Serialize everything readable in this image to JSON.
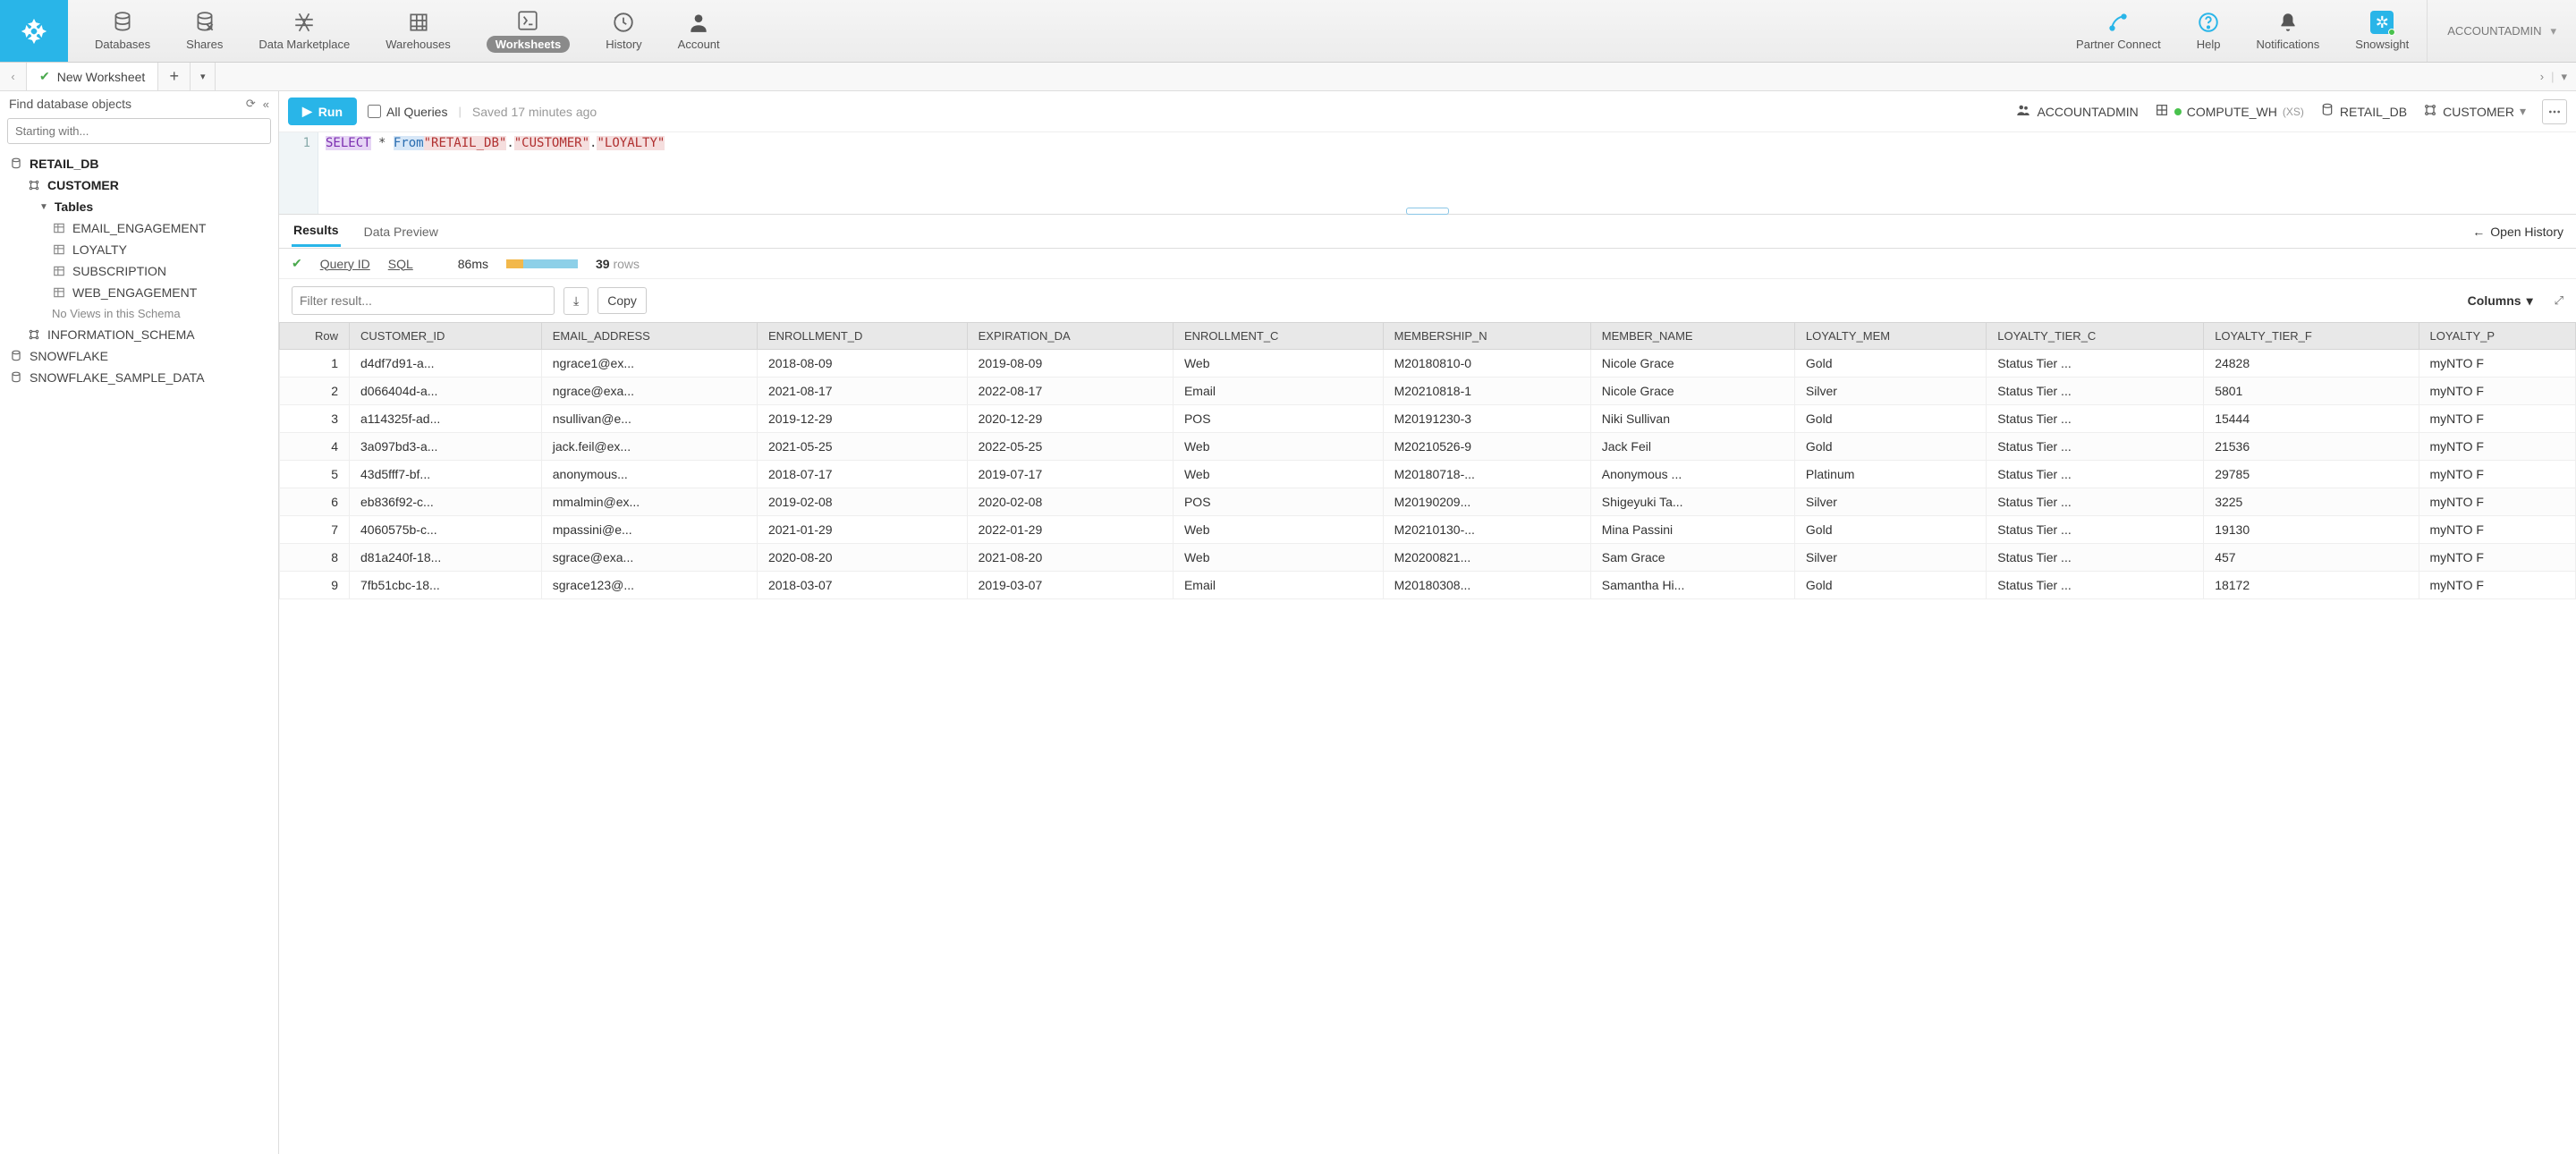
{
  "nav": {
    "items": [
      {
        "label": "Databases"
      },
      {
        "label": "Shares"
      },
      {
        "label": "Data Marketplace"
      },
      {
        "label": "Warehouses"
      },
      {
        "label": "Worksheets"
      },
      {
        "label": "History"
      },
      {
        "label": "Account"
      }
    ],
    "right": [
      {
        "label": "Partner Connect"
      },
      {
        "label": "Help"
      },
      {
        "label": "Notifications"
      },
      {
        "label": "Snowsight"
      }
    ],
    "account_role": "ACCOUNTADMIN"
  },
  "tabs": {
    "current": "New Worksheet"
  },
  "sidebar": {
    "find_label": "Find database objects",
    "search_placeholder": "Starting with...",
    "db": "RETAIL_DB",
    "schema": "CUSTOMER",
    "tables_label": "Tables",
    "tables": [
      "EMAIL_ENGAGEMENT",
      "LOYALTY",
      "SUBSCRIPTION",
      "WEB_ENGAGEMENT"
    ],
    "no_views": "No Views in this Schema",
    "info_schema": "INFORMATION_SCHEMA",
    "other_dbs": [
      "SNOWFLAKE",
      "SNOWFLAKE_SAMPLE_DATA"
    ]
  },
  "toolbar": {
    "run": "Run",
    "all_queries": "All Queries",
    "saved": "Saved 17 minutes ago",
    "role": "ACCOUNTADMIN",
    "warehouse": "COMPUTE_WH",
    "warehouse_size": "(XS)",
    "database": "RETAIL_DB",
    "schema": "CUSTOMER"
  },
  "editor": {
    "line_no": "1",
    "kw_select": "SELECT",
    "star": " * ",
    "kw_from": "From",
    "str1": "\"RETAIL_DB\"",
    "dot": ".",
    "str2": "\"CUSTOMER\"",
    "str3": "\"LOYALTY\""
  },
  "results": {
    "tab_results": "Results",
    "tab_preview": "Data Preview",
    "open_history": "Open History",
    "query_id": "Query ID",
    "sql": "SQL",
    "duration": "86ms",
    "row_count": "39",
    "rows_label": "rows",
    "filter_placeholder": "Filter result...",
    "copy": "Copy",
    "columns": "Columns",
    "headers": [
      "Row",
      "CUSTOMER_ID",
      "EMAIL_ADDRESS",
      "ENROLLMENT_D",
      "EXPIRATION_DA",
      "ENROLLMENT_C",
      "MEMBERSHIP_N",
      "MEMBER_NAME",
      "LOYALTY_MEM",
      "LOYALTY_TIER_C",
      "LOYALTY_TIER_F",
      "LOYALTY_P"
    ],
    "rows": [
      {
        "n": "1",
        "cid": "d4df7d91-a...",
        "email": "ngrace1@ex...",
        "enr": "2018-08-09",
        "exp": "2019-08-09",
        "ch": "Web",
        "mem": "M20180810-0",
        "name": "Nicole Grace",
        "tier": "Gold",
        "tc": "Status Tier ...",
        "pts": "24828",
        "prg": "myNTO F"
      },
      {
        "n": "2",
        "cid": "d066404d-a...",
        "email": "ngrace@exa...",
        "enr": "2021-08-17",
        "exp": "2022-08-17",
        "ch": "Email",
        "mem": "M20210818-1",
        "name": "Nicole Grace",
        "tier": "Silver",
        "tc": "Status Tier ...",
        "pts": "5801",
        "prg": "myNTO F"
      },
      {
        "n": "3",
        "cid": "a114325f-ad...",
        "email": "nsullivan@e...",
        "enr": "2019-12-29",
        "exp": "2020-12-29",
        "ch": "POS",
        "mem": "M20191230-3",
        "name": "Niki Sullivan",
        "tier": "Gold",
        "tc": "Status Tier ...",
        "pts": "15444",
        "prg": "myNTO F"
      },
      {
        "n": "4",
        "cid": "3a097bd3-a...",
        "email": "jack.feil@ex...",
        "enr": "2021-05-25",
        "exp": "2022-05-25",
        "ch": "Web",
        "mem": "M20210526-9",
        "name": "Jack Feil",
        "tier": "Gold",
        "tc": "Status Tier ...",
        "pts": "21536",
        "prg": "myNTO F"
      },
      {
        "n": "5",
        "cid": "43d5fff7-bf...",
        "email": "anonymous...",
        "enr": "2018-07-17",
        "exp": "2019-07-17",
        "ch": "Web",
        "mem": "M20180718-...",
        "name": "Anonymous ...",
        "tier": "Platinum",
        "tc": "Status Tier ...",
        "pts": "29785",
        "prg": "myNTO F"
      },
      {
        "n": "6",
        "cid": "eb836f92-c...",
        "email": "mmalmin@ex...",
        "enr": "2019-02-08",
        "exp": "2020-02-08",
        "ch": "POS",
        "mem": "M20190209...",
        "name": "Shigeyuki Ta...",
        "tier": "Silver",
        "tc": "Status Tier ...",
        "pts": "3225",
        "prg": "myNTO F"
      },
      {
        "n": "7",
        "cid": "4060575b-c...",
        "email": "mpassini@e...",
        "enr": "2021-01-29",
        "exp": "2022-01-29",
        "ch": "Web",
        "mem": "M20210130-...",
        "name": "Mina Passini",
        "tier": "Gold",
        "tc": "Status Tier ...",
        "pts": "19130",
        "prg": "myNTO F"
      },
      {
        "n": "8",
        "cid": "d81a240f-18...",
        "email": "sgrace@exa...",
        "enr": "2020-08-20",
        "exp": "2021-08-20",
        "ch": "Web",
        "mem": "M20200821...",
        "name": "Sam Grace",
        "tier": "Silver",
        "tc": "Status Tier ...",
        "pts": "457",
        "prg": "myNTO F"
      },
      {
        "n": "9",
        "cid": "7fb51cbc-18...",
        "email": "sgrace123@...",
        "enr": "2018-03-07",
        "exp": "2019-03-07",
        "ch": "Email",
        "mem": "M20180308...",
        "name": "Samantha Hi...",
        "tier": "Gold",
        "tc": "Status Tier ...",
        "pts": "18172",
        "prg": "myNTO F"
      }
    ]
  }
}
